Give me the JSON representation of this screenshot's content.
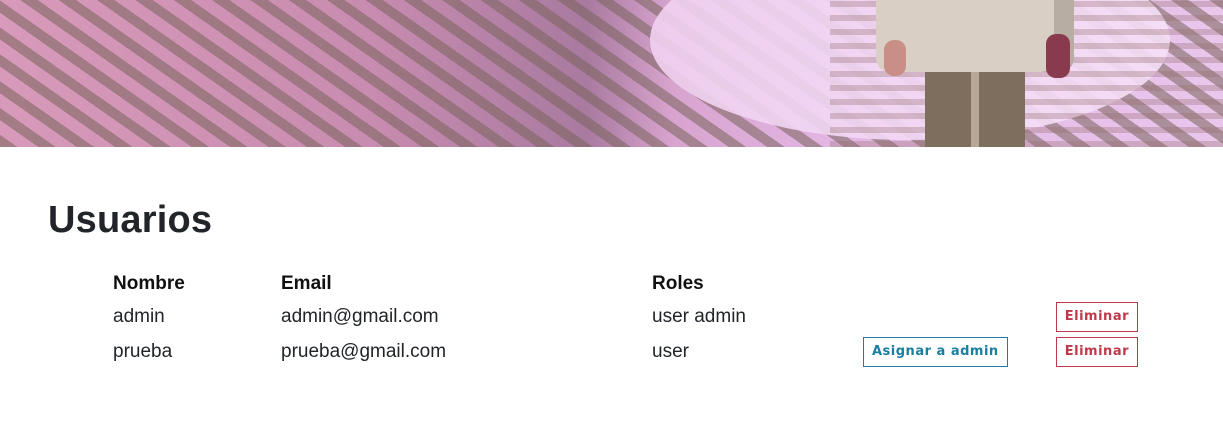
{
  "page": {
    "title": "Usuarios"
  },
  "table": {
    "headers": {
      "name": "Nombre",
      "email": "Email",
      "roles": "Roles"
    },
    "rows": [
      {
        "name": "admin",
        "email": "admin@gmail.com",
        "roles": "user admin",
        "assign_label": "",
        "delete_label": "Eliminar"
      },
      {
        "name": "prueba",
        "email": "prueba@gmail.com",
        "roles": "user",
        "assign_label": "Asignar a admin",
        "delete_label": "Eliminar"
      }
    ]
  },
  "colors": {
    "danger": "#c0394a",
    "info": "#1a7ea0",
    "text": "#212529"
  }
}
